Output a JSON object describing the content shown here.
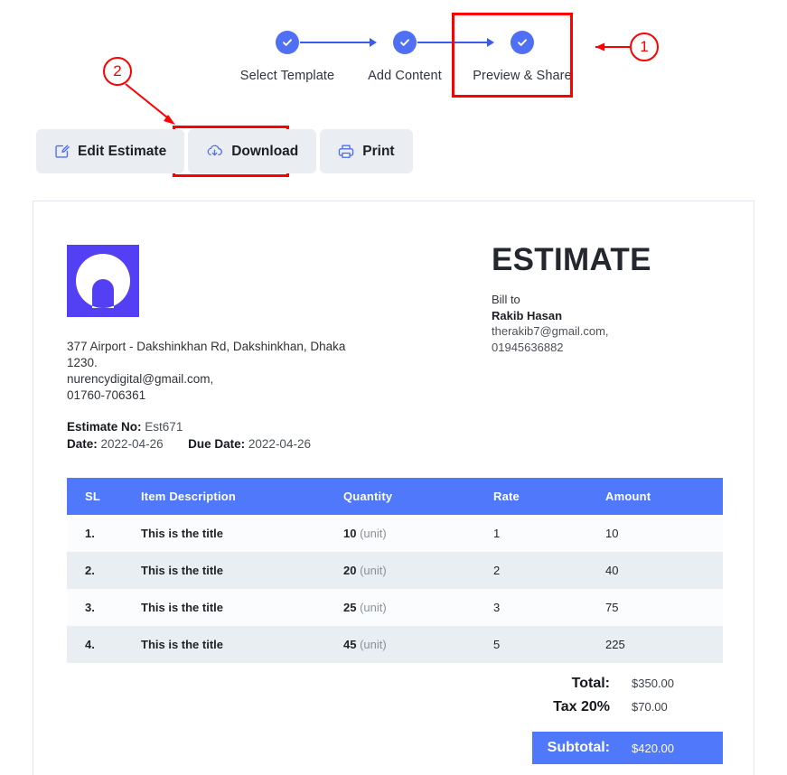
{
  "stepper": {
    "steps": [
      {
        "label": "Select Template",
        "state": "complete",
        "icon": "check-icon"
      },
      {
        "label": "Add Content",
        "state": "complete",
        "icon": "check-icon"
      },
      {
        "label": "Preview & Share",
        "state": "complete",
        "icon": "check-icon"
      }
    ],
    "accent_color": "#4f6ff5"
  },
  "annotations": [
    {
      "id": "1",
      "label": "1",
      "target": "preview-share-step",
      "color": "#ff0000"
    },
    {
      "id": "2",
      "label": "2",
      "target": "download-button",
      "color": "#ff0000"
    }
  ],
  "toolbar": {
    "buttons": [
      {
        "label": "Edit Estimate",
        "icon": "edit-square-icon"
      },
      {
        "label": "Download",
        "icon": "cloud-download-icon"
      },
      {
        "label": "Print",
        "icon": "printer-icon"
      }
    ],
    "background_color": "#eaeef2"
  },
  "document": {
    "logo": {
      "icon": "moon-arch-logo-icon",
      "background_color": "#5340f5"
    },
    "title": "ESTIMATE",
    "company": {
      "address_line1": "377 Airport - Dakshinkhan Rd, Dakshinkhan, Dhaka",
      "address_line2": "1230.",
      "email": "nurencydigital@gmail.com,",
      "phone": "01760-706361"
    },
    "meta": {
      "estimate_no_label": "Estimate No:",
      "estimate_no_value": "Est671",
      "date_label": "Date:",
      "date_value": "2022-04-26",
      "due_date_label": "Due Date:",
      "due_date_value": "2022-04-26"
    },
    "bill_to": {
      "heading": "Bill to",
      "name": "Rakib Hasan",
      "email": "therakib7@gmail.com,",
      "phone": "01945636882"
    },
    "table": {
      "header_color": "#5078fb",
      "columns": [
        "SL",
        "Item Description",
        "Quantity",
        "Rate",
        "Amount"
      ],
      "rows": [
        {
          "sl": "1.",
          "description": "This is the title",
          "quantity": "10",
          "unit": "(unit)",
          "rate": "1",
          "amount": "10"
        },
        {
          "sl": "2.",
          "description": "This is the title",
          "quantity": "20",
          "unit": "(unit)",
          "rate": "2",
          "amount": "40"
        },
        {
          "sl": "3.",
          "description": "This is the title",
          "quantity": "25",
          "unit": "(unit)",
          "rate": "3",
          "amount": "75"
        },
        {
          "sl": "4.",
          "description": "This is the title",
          "quantity": "45",
          "unit": "(unit)",
          "rate": "5",
          "amount": "225"
        }
      ]
    },
    "totals": {
      "total_label": "Total:",
      "total_value": "$350.00",
      "tax_label": "Tax 20%",
      "tax_value": "$70.00",
      "subtotal_label": "Subtotal:",
      "subtotal_value": "$420.00",
      "subtotal_color": "#5078fb"
    }
  }
}
